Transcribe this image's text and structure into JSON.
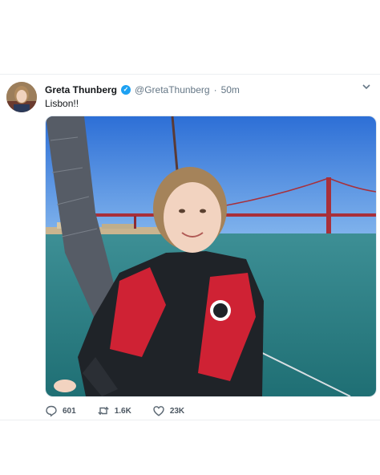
{
  "tweet": {
    "author_name": "Greta Thunberg",
    "author_handle": "@GretaThunberg",
    "separator": "·",
    "time": "50m",
    "text": "Lisbon!!",
    "verified": true,
    "photo_alt": "Greta Thunberg on a sailboat in front of the 25 de Abril bridge in Lisbon"
  },
  "actions": {
    "reply_count": "601",
    "retweet_count": "1.6K",
    "like_count": "23K"
  },
  "icons": {
    "verified": "verified-badge-icon",
    "menu": "chevron-down-icon",
    "reply": "reply-icon",
    "retweet": "retweet-icon",
    "like": "heart-icon"
  },
  "colors": {
    "verified_blue": "#1da1f2",
    "sky": "#2f7de0",
    "water": "#2a8a8e",
    "bridge_red": "#a8303a",
    "vest_red": "#cf2234"
  }
}
